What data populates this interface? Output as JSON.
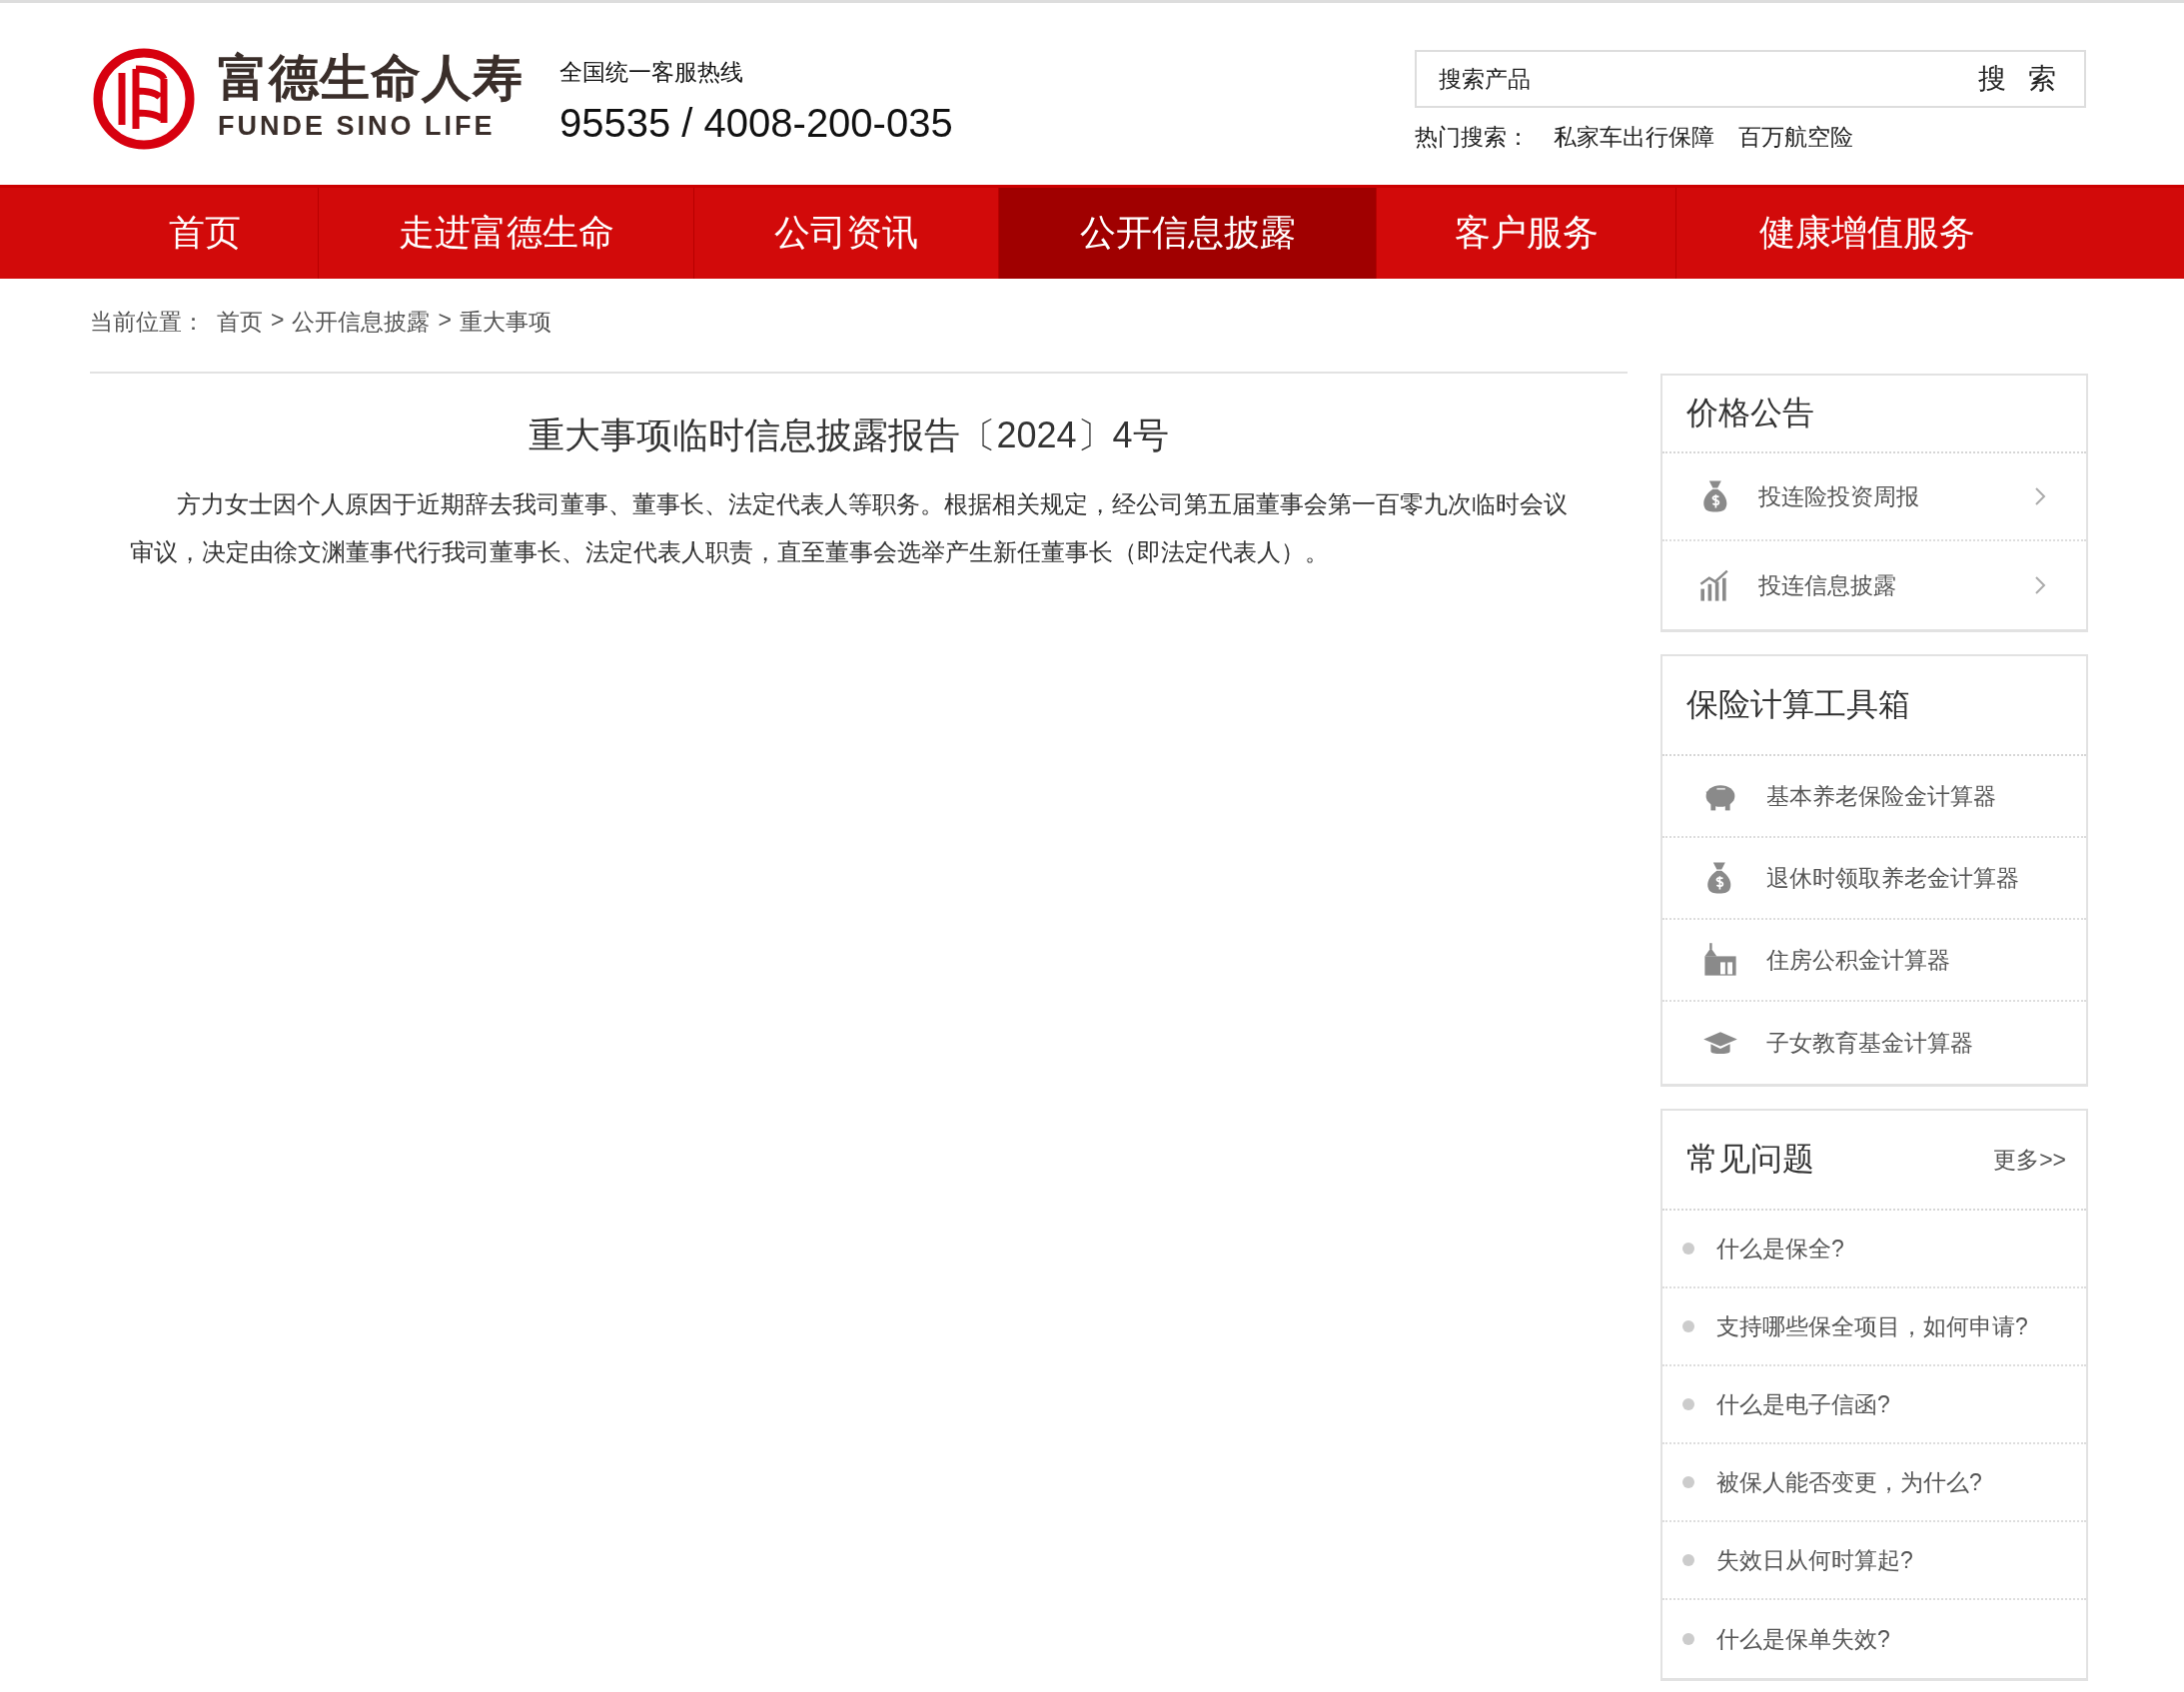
{
  "header": {
    "logo": {
      "name_cn": "富德生命人寿",
      "name_en": "FUNDE SINO LIFE"
    },
    "hotline": {
      "label": "全国统一客服热线",
      "number": "95535 / 4008-200-035"
    },
    "search": {
      "placeholder": "搜索产品",
      "button": "搜 索"
    },
    "hot_search": {
      "label": "热门搜索：",
      "links": [
        "私家车出行保障",
        "百万航空险"
      ]
    }
  },
  "nav": [
    {
      "label": "首页",
      "selected": false
    },
    {
      "label": "走进富德生命",
      "selected": false
    },
    {
      "label": "公司资讯",
      "selected": false
    },
    {
      "label": "公开信息披露",
      "selected": true
    },
    {
      "label": "客户服务",
      "selected": false
    },
    {
      "label": "健康增值服务",
      "selected": false
    }
  ],
  "breadcrumb": {
    "label": "当前位置：",
    "separator": ">",
    "items": [
      "首页",
      "公开信息披露",
      "重大事项"
    ]
  },
  "article": {
    "title": "重大事项临时信息披露报告〔2024〕4号",
    "paragraph": "方力女士因个人原因于近期辞去我司董事、董事长、法定代表人等职务。根据相关规定，经公司第五届董事会第一百零九次临时会议审议，决定由徐文渊董事代行我司董事长、法定代表人职责，直至董事会选举产生新任董事长（即法定代表人）。"
  },
  "sidebar": {
    "price_notice": {
      "title": "价格公告",
      "items": [
        {
          "label": "投连险投资周报",
          "kind": "money-bag"
        },
        {
          "label": "投连信息披露",
          "kind": "chart"
        }
      ]
    },
    "calculators": {
      "title": "保险计算工具箱",
      "items": [
        {
          "label": "基本养老保险金计算器",
          "kind": "piggy-bank"
        },
        {
          "label": "退休时领取养老金计算器",
          "kind": "money-bag"
        },
        {
          "label": "住房公积金计算器",
          "kind": "house"
        },
        {
          "label": "子女教育基金计算器",
          "kind": "graduation-cap"
        }
      ]
    },
    "faq": {
      "title": "常见问题",
      "more": "更多>>",
      "items": [
        "什么是保全?",
        "支持哪些保全项目，如何申请?",
        "什么是电子信函?",
        "被保人能否变更，为什么?",
        "失效日从何时算起?",
        "什么是保单失效?"
      ]
    }
  }
}
